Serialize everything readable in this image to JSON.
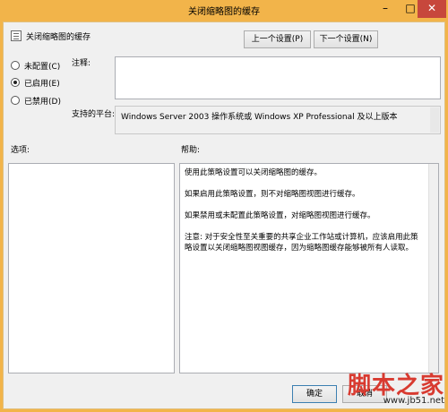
{
  "window": {
    "title": "关闭缩略图的缓存",
    "min_glyph": "–",
    "max_glyph": "□",
    "close_glyph": "✕"
  },
  "header": {
    "policy_name": "关闭缩略图的缓存",
    "prev_button": "上一个设置(P)",
    "next_button": "下一个设置(N)"
  },
  "state": {
    "options": [
      {
        "label": "未配置(C)",
        "selected": false
      },
      {
        "label": "已启用(E)",
        "selected": true
      },
      {
        "label": "已禁用(D)",
        "selected": false
      }
    ]
  },
  "comment": {
    "label": "注释:",
    "value": ""
  },
  "platform": {
    "label": "支持的平台:",
    "value": "Windows Server 2003 操作系统或 Windows XP Professional 及以上版本"
  },
  "options_section": {
    "label": "选项:"
  },
  "help_section": {
    "label": "帮助:",
    "paragraphs": [
      "使用此策略设置可以关闭缩略图的缓存。",
      "如果启用此策略设置，则不对缩略图视图进行缓存。",
      "如果禁用或未配置此策略设置，对缩略图视图进行缓存。",
      "注意: 对于安全性至关重要的共享企业工作站或计算机，应该启用此策略设置以关闭缩略图视图缓存，因为缩略图缓存能够被所有人读取。"
    ]
  },
  "footer": {
    "ok_button": "确定",
    "cancel_button": "取消"
  },
  "watermark": {
    "text": "脚本之家",
    "url": "www.jb51.net"
  },
  "colors": {
    "titlebar": "#f2b44a",
    "close_button": "#c7473c",
    "watermark_red": "#d83a30"
  }
}
